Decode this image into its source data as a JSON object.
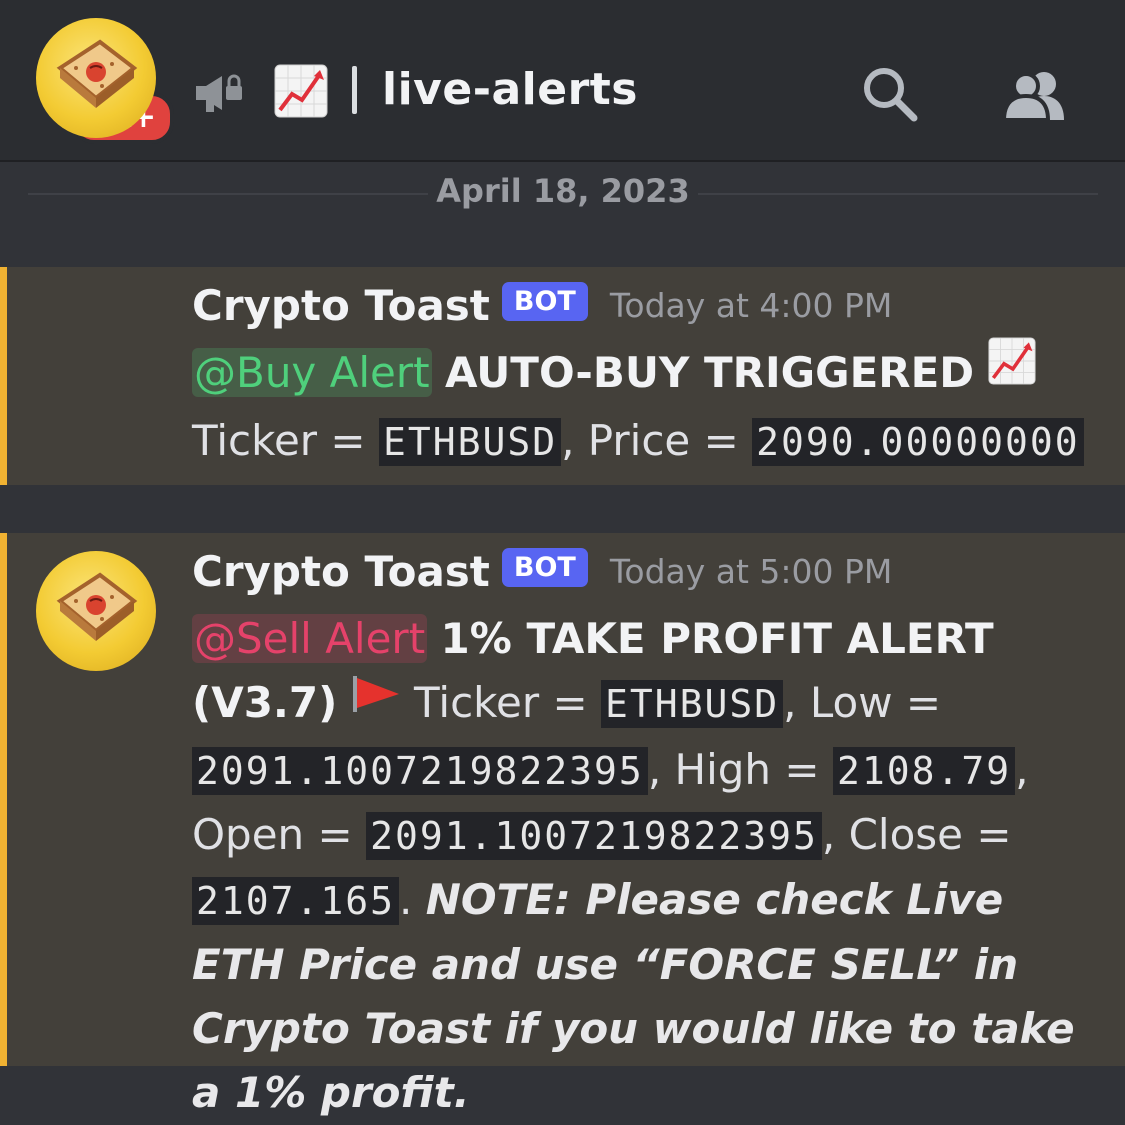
{
  "header": {
    "notification_badge": "9k+",
    "channel_name": "live-alerts"
  },
  "date_separator": "April 18, 2023",
  "messages": [
    {
      "username": "Crypto Toast",
      "bot_tag": "BOT",
      "timestamp": "Today at 4:00 PM",
      "mention": "@Buy Alert",
      "headline": "AUTO-BUY TRIGGERED",
      "emoji": "chart-increasing-icon",
      "ticker_label": "Ticker = ",
      "ticker_value": "ETHBUSD",
      "price_label": ", Price = ",
      "price_value": "2090.00000000"
    },
    {
      "username": "Crypto Toast",
      "bot_tag": "BOT",
      "timestamp": "Today at 5:00 PM",
      "mention": "@Sell Alert",
      "headline": "1% TAKE PROFIT ALERT",
      "version": "(V3.7)",
      "emoji": "triangular-flag-icon",
      "ticker_label": "Ticker = ",
      "ticker_value": "ETHBUSD",
      "low_label": ", Low = ",
      "low_value": "2091.1007219822395",
      "high_label": ", High = ",
      "high_value": "2108.79",
      "open_label": "Open = ",
      "open_value": "2091.1007219822395",
      "close_label": ", Close = ",
      "close_value": "2107.165",
      "period": ".",
      "note": "NOTE: Please check Live ETH Price and use “FORCE SELL” in Crypto Toast if you would like to take a 1% profit."
    }
  ],
  "colors": {
    "background": "#313338",
    "header": "#2b2d31",
    "highlight_row": "#43403a",
    "accent_bar": "#f0b232",
    "bot_tag": "#5865f2",
    "buy_mention": "#4fd07c",
    "sell_mention": "#e5426a",
    "badge": "#e0423e"
  }
}
